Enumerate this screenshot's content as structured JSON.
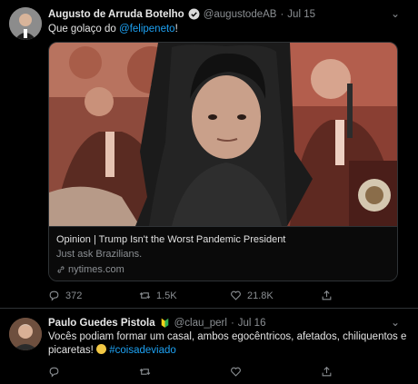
{
  "tweet1": {
    "author_name": "Augusto de Arruda Botelho",
    "handle": "@augustodeAB",
    "separator": "·",
    "date": "Jul 15",
    "text_before": "Que golaço do ",
    "mention": "@felipeneto",
    "text_after": "!",
    "card": {
      "title": "Opinion | Trump Isn't the Worst Pandemic President",
      "description": "Just ask Brazilians.",
      "source": "nytimes.com"
    },
    "counts": {
      "replies": "372",
      "retweets": "1.5K",
      "likes": "21.8K"
    }
  },
  "tweet2": {
    "author_name": "Paulo Guedes Pistola",
    "handle": "@clau_perl",
    "separator": "·",
    "date": "Jul 16",
    "text": "Vocês podiam formar um casal, ambos egocêntricos, afetados, chiliquentos e picaretas! ",
    "hashtag": "#coisadeviado"
  },
  "colors": {
    "background": "#000000",
    "accent": "#1da1f2",
    "muted": "#8b8f93",
    "border": "#2f3336"
  },
  "icons": [
    "verified-badge-icon",
    "chevron-down-icon",
    "reply-icon",
    "retweet-icon",
    "like-icon",
    "share-icon",
    "link-icon",
    "beginner-badge-icon"
  ]
}
